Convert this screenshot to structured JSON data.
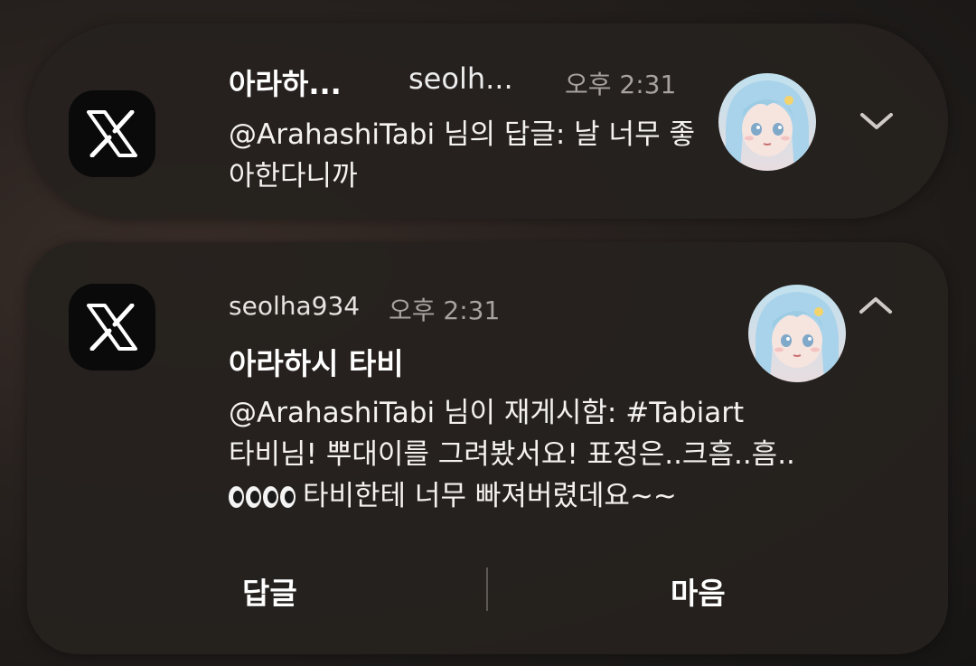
{
  "notifications": [
    {
      "state": "collapsed",
      "app_icon": "x-logo-icon",
      "title": "아라하...",
      "username": "seolh...",
      "time": "오후 2:31",
      "body": "@ArahashiTabi 님의 답글: 날 너무 좋아한다니까",
      "avatar": "anime-avatar",
      "chevron": "chevron-down-icon"
    },
    {
      "state": "expanded",
      "app_icon": "x-logo-icon",
      "username": "seolha934",
      "time": "오후 2:31",
      "title": "아라하시 타비",
      "body_lines": [
        "@ArahashiTabi 님이 재게시함: #Tabiart",
        "타비님! 뿌대이를 그려봤서요! 표정은..크흠..흠..",
        "타비한테 너무 빠져버렸데요~~"
      ],
      "emoji": "eyes-emoji",
      "avatar": "anime-avatar",
      "chevron": "chevron-up-icon",
      "actions": {
        "reply": "답글",
        "like": "마음"
      }
    }
  ],
  "colors": {
    "card_bg": "#26211e",
    "icon_bg": "#0a0a0a",
    "muted_text": "#a8a29e",
    "divider": "#5e5855"
  }
}
